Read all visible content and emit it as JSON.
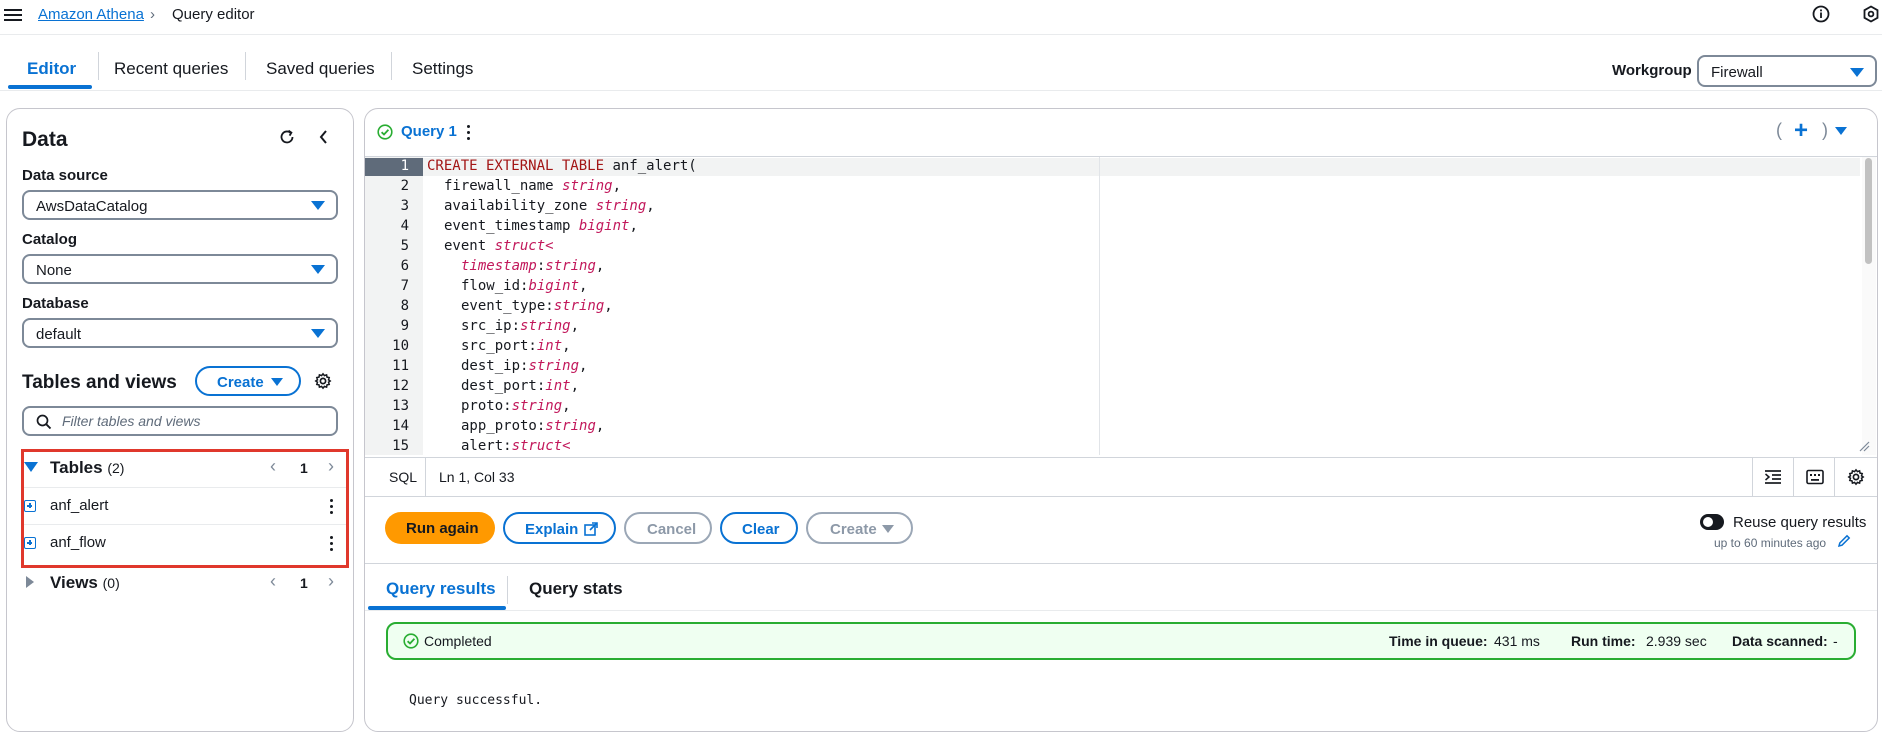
{
  "breadcrumb": {
    "service": "Amazon Athena",
    "current": "Query editor"
  },
  "header_icons": [
    "info-icon",
    "settings-hex-icon"
  ],
  "tabs": [
    {
      "label": "Editor",
      "active": true
    },
    {
      "label": "Recent queries",
      "active": false
    },
    {
      "label": "Saved queries",
      "active": false
    },
    {
      "label": "Settings",
      "active": false
    }
  ],
  "workgroup": {
    "label": "Workgroup",
    "value": "Firewall"
  },
  "data_panel": {
    "title": "Data",
    "data_source": {
      "label": "Data source",
      "value": "AwsDataCatalog"
    },
    "catalog": {
      "label": "Catalog",
      "value": "None"
    },
    "database": {
      "label": "Database",
      "value": "default"
    },
    "tables_views": {
      "title": "Tables and views",
      "create_label": "Create",
      "filter_placeholder": "Filter tables and views",
      "tables": {
        "label": "Tables",
        "count": "(2)",
        "page": "1",
        "items": [
          "anf_alert",
          "anf_flow"
        ]
      },
      "views": {
        "label": "Views",
        "count": "(0)",
        "page": "1"
      }
    }
  },
  "query_tab": {
    "label": "Query 1",
    "status": "completed"
  },
  "editor": {
    "lines": [
      "1",
      "2",
      "3",
      "4",
      "5",
      "6",
      "7",
      "8",
      "9",
      "10",
      "11",
      "12",
      "13",
      "14",
      "15"
    ],
    "code": {
      "l1_kw": "CREATE EXTERNAL TABLE",
      "l1_name": " anf_alert(",
      "l2_f": "firewall_name ",
      "l2_t": "string",
      "l2_e": ",",
      "l3_f": "availability_zone ",
      "l3_t": "string",
      "l3_e": ",",
      "l4_f": "event_timestamp ",
      "l4_t": "bigint",
      "l4_e": ",",
      "l5_f": "event ",
      "l5_t": "struct<",
      "l6_f": "timestamp",
      "l6_c": ":",
      "l6_t": "string",
      "l6_e": ",",
      "l7_f": "flow_id:",
      "l7_t": "bigint",
      "l7_e": ",",
      "l8_f": "event_type:",
      "l8_t": "string",
      "l8_e": ",",
      "l9_f": "src_ip:",
      "l9_t": "string",
      "l9_e": ",",
      "l10_f": "src_port:",
      "l10_t": "int",
      "l10_e": ",",
      "l11_f": "dest_ip:",
      "l11_t": "string",
      "l11_e": ",",
      "l12_f": "dest_port:",
      "l12_t": "int",
      "l12_e": ",",
      "l13_f": "proto:",
      "l13_t": "string",
      "l13_e": ",",
      "l14_f": "app_proto:",
      "l14_t": "string",
      "l14_e": ",",
      "l15_f": "alert:",
      "l15_t": "struct<"
    },
    "language": "SQL",
    "cursor": "Ln 1, Col 33"
  },
  "actions": {
    "run_again": "Run again",
    "explain": "Explain",
    "cancel": "Cancel",
    "clear": "Clear",
    "create": "Create",
    "reuse_label": "Reuse query results",
    "reuse_sub": "up to 60 minutes ago"
  },
  "results": {
    "tabs": [
      "Query results",
      "Query stats"
    ],
    "status": "Completed",
    "time_in_queue_label": "Time in queue:",
    "time_in_queue": "431 ms",
    "run_time_label": "Run time:",
    "run_time": "2.939 sec",
    "data_scanned_label": "Data scanned:",
    "data_scanned": "-",
    "message": "Query successful."
  },
  "colors": {
    "accent": "#0972d3",
    "primary_button": "#ff9900",
    "success": "#29ad32",
    "highlight": "#e0382c"
  }
}
